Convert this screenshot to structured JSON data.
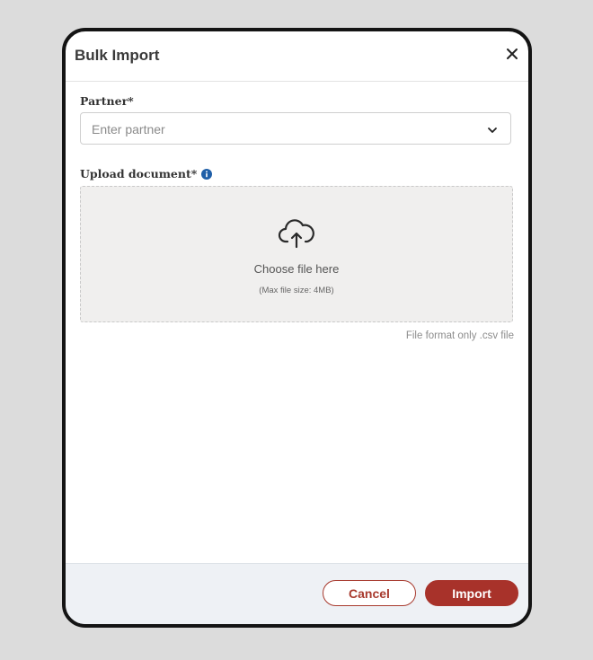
{
  "dialog": {
    "title": "Bulk Import",
    "close_icon": "close-icon"
  },
  "partner": {
    "label": "Partner*",
    "placeholder": "Enter partner",
    "dropdown_icon": "chevron-down-icon"
  },
  "upload": {
    "label": "Upload document*",
    "info_icon": "info-icon",
    "upload_icon": "cloud-upload-icon",
    "prompt": "Choose file here",
    "max_size": "(Max file size: 4MB)",
    "format_note": "File format only .csv file"
  },
  "footer": {
    "cancel_label": "Cancel",
    "import_label": "Import"
  },
  "colors": {
    "accent": "#a8322a",
    "info_blue": "#1f5fa8",
    "dropzone_bg": "#f0efee",
    "footer_bg": "#eef1f5"
  }
}
